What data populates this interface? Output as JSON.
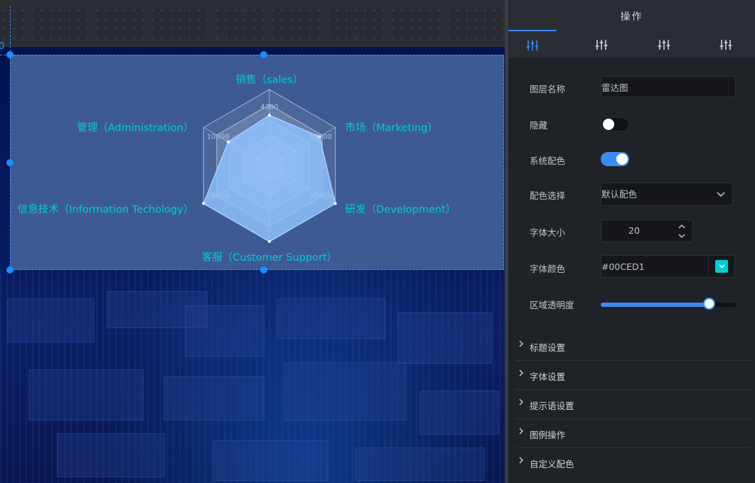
{
  "canvas": {
    "ruler_number": "0",
    "chart_data": {
      "type": "radar",
      "indicators": [
        {
          "name": "销售（sales）",
          "max": 6500,
          "tick": "4300"
        },
        {
          "name": "市场（Marketing）",
          "max": 25000,
          "tick": "19000"
        },
        {
          "name": "研发（Development）",
          "max": 38000,
          "tick": "38000"
        },
        {
          "name": "客服（Customer Support）",
          "max": 38000,
          "tick": ""
        },
        {
          "name": "信息技术（Information Techology）",
          "max": 28000,
          "tick": "28000"
        },
        {
          "name": "管理（Administration）",
          "max": 16000,
          "tick": "10000"
        }
      ],
      "series": [
        {
          "values": [
            4300,
            19000,
            38000,
            38000,
            28000,
            10000
          ]
        }
      ],
      "label_color": "#00CED1",
      "area_color": "#8ec3ff"
    }
  },
  "panel": {
    "title": "操作",
    "tabs": [
      {
        "icon": "sliders-icon",
        "active": true
      },
      {
        "icon": "sliders-icon",
        "active": false
      },
      {
        "icon": "sliders-icon",
        "active": false
      },
      {
        "icon": "sliders-icon",
        "active": false
      }
    ],
    "layer_name_label": "图层名称",
    "layer_name_value": "雷达图",
    "hide_label": "隐藏",
    "hide_on": false,
    "system_color_label": "系统配色",
    "system_color_on": true,
    "color_scheme_label": "配色选择",
    "color_scheme_value": "默认配色",
    "font_size_label": "字体大小",
    "font_size_value": "20",
    "font_color_label": "字体颜色",
    "font_color_value": "#00CED1",
    "opacity_label": "区域透明度",
    "opacity_value": 0.8,
    "sections": [
      "标题设置",
      "字体设置",
      "提示语设置",
      "图例操作",
      "自定义配色"
    ]
  }
}
